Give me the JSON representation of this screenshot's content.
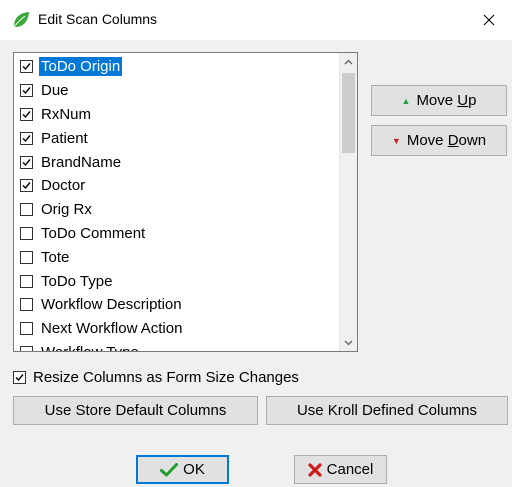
{
  "window": {
    "title": "Edit Scan Columns"
  },
  "columns": {
    "items": [
      {
        "label": "ToDo Origin",
        "checked": true,
        "selected": true
      },
      {
        "label": "Due",
        "checked": true,
        "selected": false
      },
      {
        "label": "RxNum",
        "checked": true,
        "selected": false
      },
      {
        "label": "Patient",
        "checked": true,
        "selected": false
      },
      {
        "label": "BrandName",
        "checked": true,
        "selected": false
      },
      {
        "label": "Doctor",
        "checked": true,
        "selected": false
      },
      {
        "label": "Orig Rx",
        "checked": false,
        "selected": false
      },
      {
        "label": "ToDo Comment",
        "checked": false,
        "selected": false
      },
      {
        "label": "Tote",
        "checked": false,
        "selected": false
      },
      {
        "label": "ToDo Type",
        "checked": false,
        "selected": false
      },
      {
        "label": "Workflow Description",
        "checked": false,
        "selected": false
      },
      {
        "label": "Next Workflow Action",
        "checked": false,
        "selected": false
      },
      {
        "label": "Workflow Type",
        "checked": false,
        "selected": false
      }
    ]
  },
  "buttons": {
    "move_up_pre": "Move ",
    "move_up_key": "U",
    "move_up_post": "p",
    "move_down_pre": "Move ",
    "move_down_key": "D",
    "move_down_post": "own",
    "store_default": "Use Store Default Columns",
    "kroll_defined": "Use Kroll Defined Columns",
    "ok": "OK",
    "cancel": "Cancel"
  },
  "options": {
    "resize_label": "Resize Columns as Form Size Changes",
    "resize_checked": true
  },
  "colors": {
    "selection": "#0078d7",
    "move_up_arrow": "#1aa33a",
    "move_down_arrow": "#d01c1c",
    "ok_check": "#1f9e2e",
    "cancel_x": "#cc1b1b",
    "leaf": "#3aa83a"
  },
  "icons": {
    "app": "leaf-icon",
    "close": "close-icon",
    "move_up": "triangle-up-icon",
    "move_down": "triangle-down-icon",
    "ok": "checkmark-icon",
    "cancel": "x-icon"
  }
}
